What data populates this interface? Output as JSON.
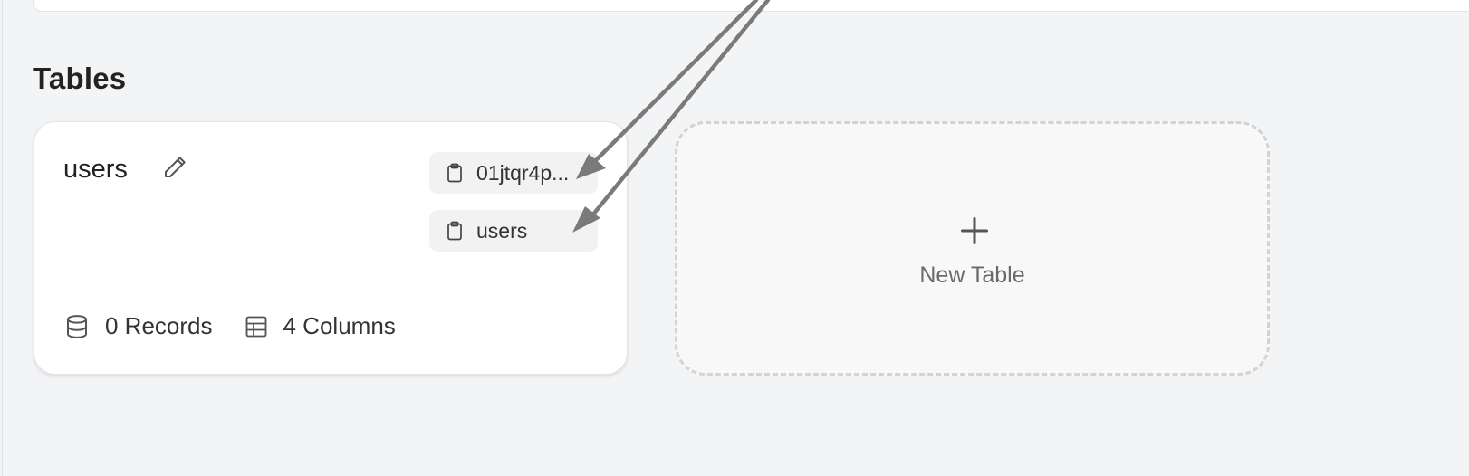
{
  "section": {
    "title": "Tables"
  },
  "table_card": {
    "name": "users",
    "id_chip": "01jtqr4p...",
    "name_chip": "users",
    "records": "0 Records",
    "columns": "4 Columns"
  },
  "new_table": {
    "label": "New Table"
  },
  "colors": {
    "background": "#f3f4f6",
    "card": "#ffffff",
    "chip": "#f2f2f3",
    "dashed_border": "#d3d3d3",
    "arrow": "#7a7a7a"
  },
  "icons": {
    "edit": "pencil-icon",
    "chip": "clipboard-icon",
    "records": "database-icon",
    "columns": "table-grid-icon",
    "new": "plus-icon"
  }
}
